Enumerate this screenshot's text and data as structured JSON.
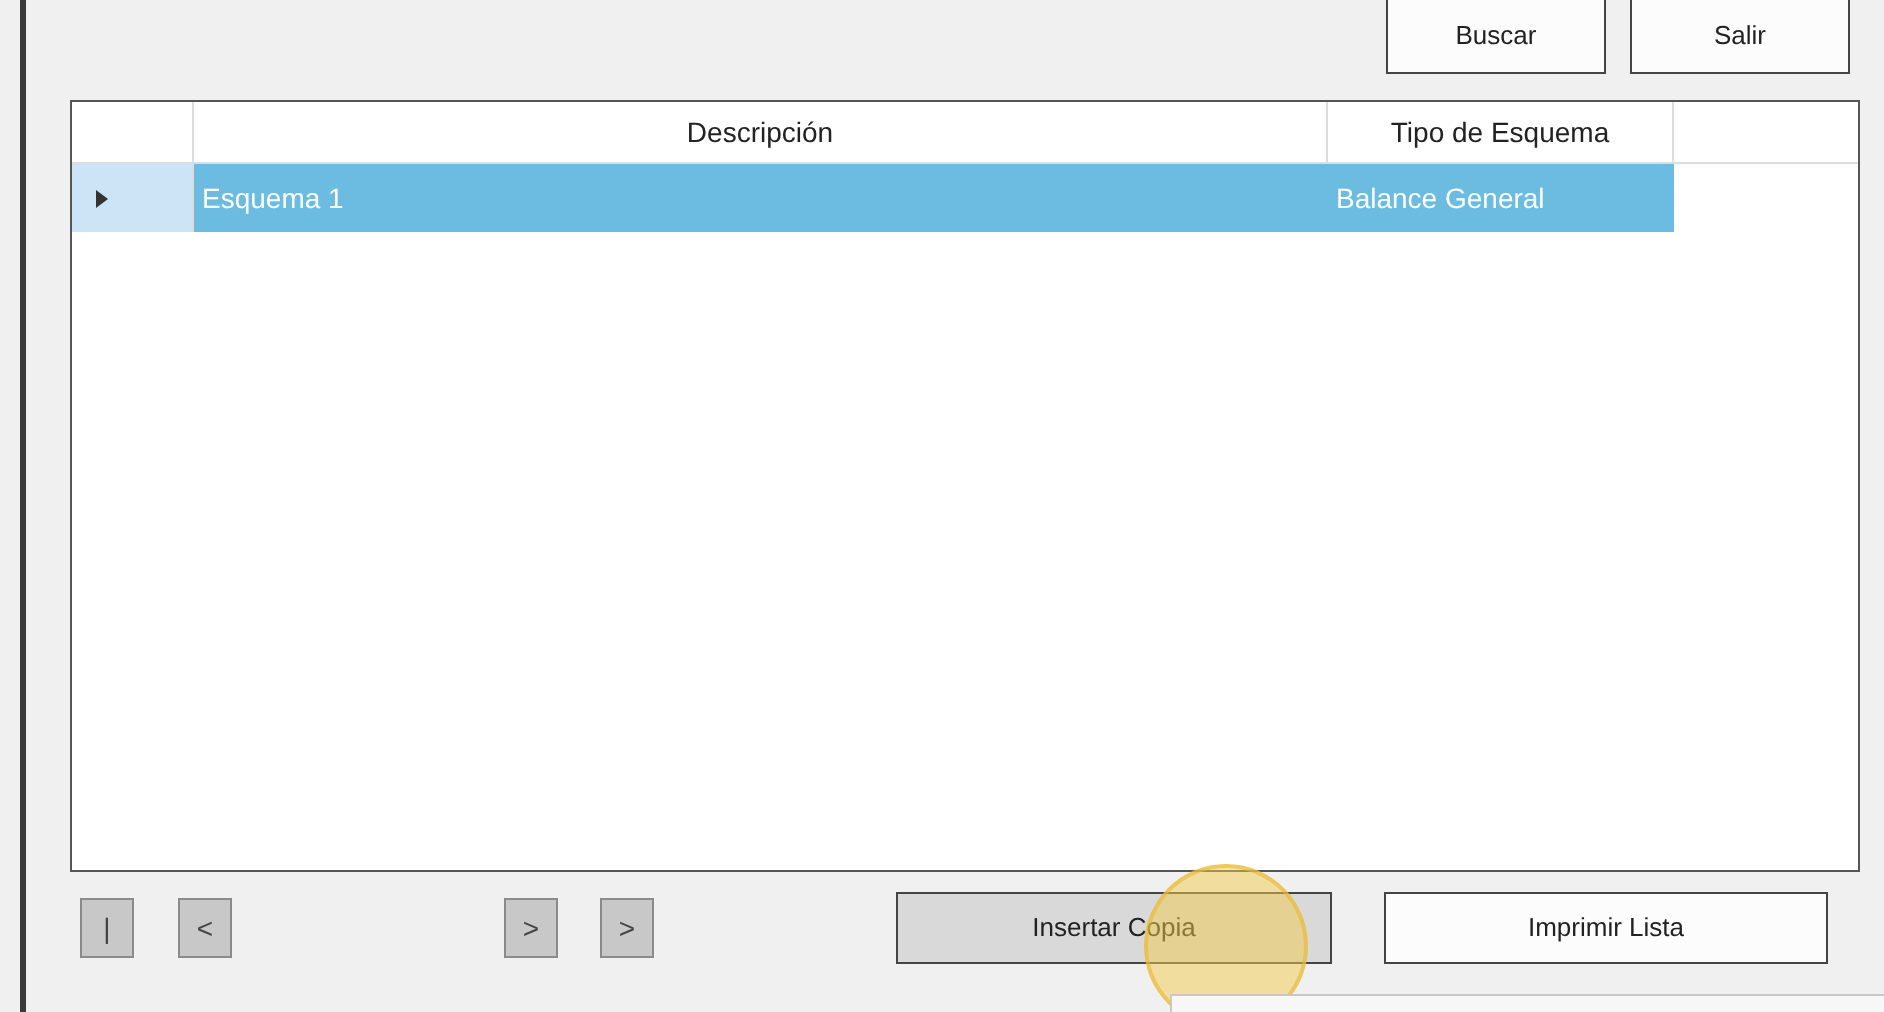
{
  "top_buttons": [
    "Buscar",
    "Salir"
  ],
  "table": {
    "columns": [
      "Descripción",
      "Tipo de Esquema"
    ],
    "rows": [
      {
        "cells": [
          "Esquema 1",
          "Balance General"
        ],
        "selected": true,
        "current": true
      }
    ]
  },
  "nav_buttons": [
    {
      "label": "|"
    },
    {
      "label": "<"
    },
    {
      "label": ">"
    },
    {
      "label": ">"
    }
  ],
  "bottom_buttons": [
    {
      "label": "Insertar Copia",
      "kind": "shaded"
    },
    {
      "label": "Imprimir Lista",
      "kind": "plain"
    }
  ]
}
